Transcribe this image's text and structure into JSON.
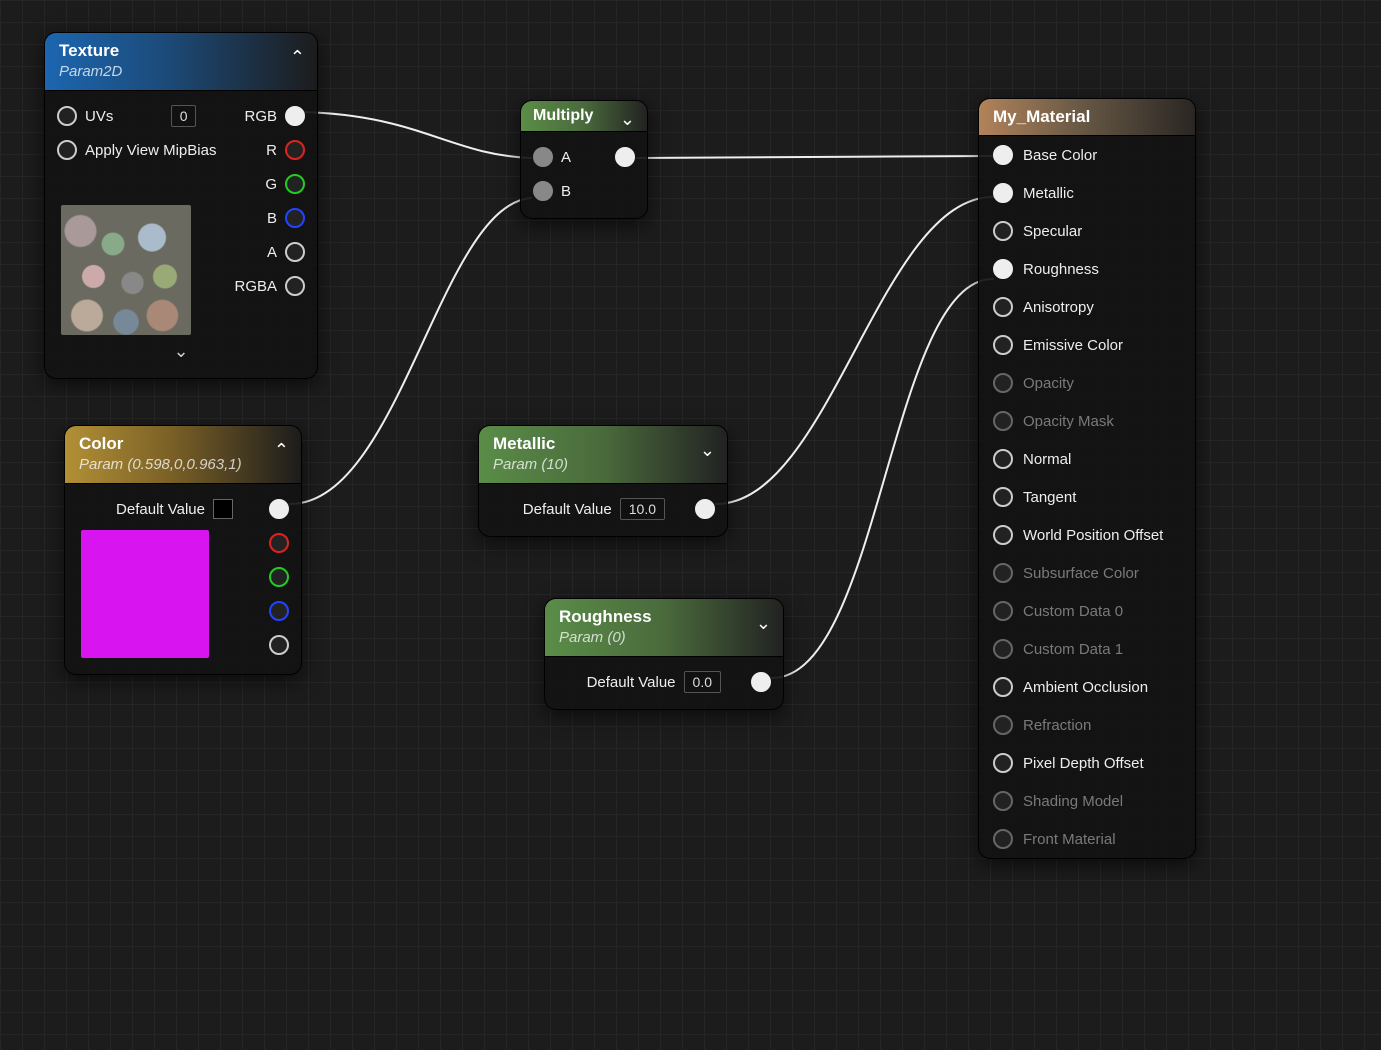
{
  "texture_node": {
    "title": "Texture",
    "subtitle": "Param2D",
    "uvs_label": "UVs",
    "uvs_value": "0",
    "mip_label": "Apply View MipBias",
    "out_rgb": "RGB",
    "out_r": "R",
    "out_g": "G",
    "out_b": "B",
    "out_a": "A",
    "out_rgba": "RGBA"
  },
  "color_node": {
    "title": "Color",
    "subtitle": "Param (0.598,0,0.963,1)",
    "default_label": "Default Value"
  },
  "multiply_node": {
    "title": "Multiply",
    "in_a": "A",
    "in_b": "B"
  },
  "metallic_node": {
    "title": "Metallic",
    "subtitle": "Param (10)",
    "default_label": "Default Value",
    "value": "10.0"
  },
  "roughness_node": {
    "title": "Roughness",
    "subtitle": "Param (0)",
    "default_label": "Default Value",
    "value": "0.0"
  },
  "material_node": {
    "title": "My_Material",
    "pins": [
      {
        "label": "Base Color",
        "solid": true,
        "dim": false
      },
      {
        "label": "Metallic",
        "solid": true,
        "dim": false
      },
      {
        "label": "Specular",
        "solid": false,
        "dim": false
      },
      {
        "label": "Roughness",
        "solid": true,
        "dim": false
      },
      {
        "label": "Anisotropy",
        "solid": false,
        "dim": false
      },
      {
        "label": "Emissive Color",
        "solid": false,
        "dim": false
      },
      {
        "label": "Opacity",
        "solid": false,
        "dim": true
      },
      {
        "label": "Opacity Mask",
        "solid": false,
        "dim": true
      },
      {
        "label": "Normal",
        "solid": false,
        "dim": false
      },
      {
        "label": "Tangent",
        "solid": false,
        "dim": false
      },
      {
        "label": "World Position Offset",
        "solid": false,
        "dim": false
      },
      {
        "label": "Subsurface Color",
        "solid": false,
        "dim": true
      },
      {
        "label": "Custom Data 0",
        "solid": false,
        "dim": true
      },
      {
        "label": "Custom Data 1",
        "solid": false,
        "dim": true
      },
      {
        "label": "Ambient Occlusion",
        "solid": false,
        "dim": false
      },
      {
        "label": "Refraction",
        "solid": false,
        "dim": true
      },
      {
        "label": "Pixel Depth Offset",
        "solid": false,
        "dim": false
      },
      {
        "label": "Shading Model",
        "solid": false,
        "dim": true
      },
      {
        "label": "Front Material",
        "solid": false,
        "dim": true
      }
    ]
  }
}
